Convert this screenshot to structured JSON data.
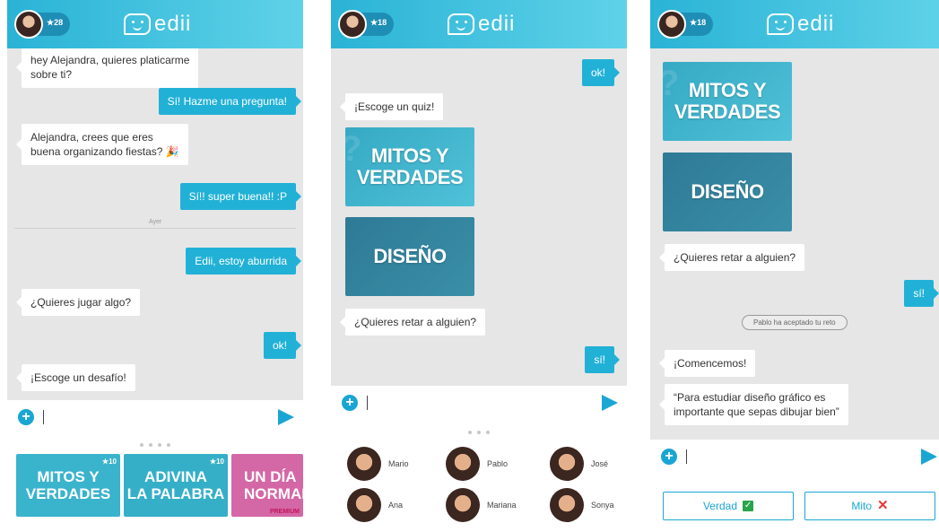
{
  "app": {
    "logo_text": "edii",
    "colors": {
      "primary": "#22b1d6",
      "header": "#2ab3d6",
      "premium": "#c2175b"
    }
  },
  "screen1": {
    "points": "★28",
    "messages": [
      {
        "dir": "in",
        "text": "hey Alejandra, quieres platicarme\nsobre ti?"
      },
      {
        "dir": "out",
        "text": "Sí! Hazme una pregunta!"
      },
      {
        "dir": "in",
        "text": "Alejandra, crees que eres\nbuena organizando fiestas? 🎉"
      },
      {
        "dir": "out",
        "text": "Sí!! super buena!! :P"
      },
      {
        "dir": "out",
        "text": "Edii, estoy aburrida"
      },
      {
        "dir": "in",
        "text": "¿Quieres jugar algo?"
      },
      {
        "dir": "out",
        "text": "ok!"
      },
      {
        "dir": "in",
        "text": "¡Escoge un desafío!"
      }
    ],
    "divider_label": "Ayer",
    "tray_cards": [
      {
        "title": "MITOS Y\nVERDADES",
        "cost": "★10",
        "color": "#3ab3cc"
      },
      {
        "title": "ADIVINA\nLA PALABRA",
        "cost": "★10",
        "color": "#35afc8"
      },
      {
        "title": "UN DÍA\nNORMAL",
        "cost": "",
        "color": "#d467a6",
        "tag": "PREMIUM"
      }
    ]
  },
  "screen2": {
    "points": "★18",
    "messages": [
      {
        "dir": "out",
        "text": "ok!"
      },
      {
        "dir": "in",
        "text": "¡Escoge un quiz!"
      },
      {
        "dir": "in",
        "text": "¿Quieres retar a alguien?"
      },
      {
        "dir": "out",
        "text": "sí!"
      }
    ],
    "quizzes": [
      {
        "title": "MITOS Y\nVERDADES"
      },
      {
        "title": "DISEÑO"
      }
    ],
    "friends": [
      {
        "name": "Mario"
      },
      {
        "name": "Pablo"
      },
      {
        "name": "José"
      },
      {
        "name": "Ana"
      },
      {
        "name": "Mariana"
      },
      {
        "name": "Sonya"
      }
    ]
  },
  "screen3": {
    "points": "★18",
    "quizzes": [
      {
        "title": "MITOS Y\nVERDADES"
      },
      {
        "title": "DISEÑO"
      }
    ],
    "messages": [
      {
        "dir": "in",
        "text": "¿Quieres retar a alguien?"
      },
      {
        "dir": "out",
        "text": "sí!"
      },
      {
        "dir": "in",
        "text": "¡Comencemos!"
      },
      {
        "dir": "in",
        "text": "“Para estudiar diseño gráfico es\nimportante que sepas dibujar bien”"
      }
    ],
    "system": "Pablo ha aceptado tu reto",
    "answer_true": "Verdad",
    "answer_false": "Mito"
  }
}
